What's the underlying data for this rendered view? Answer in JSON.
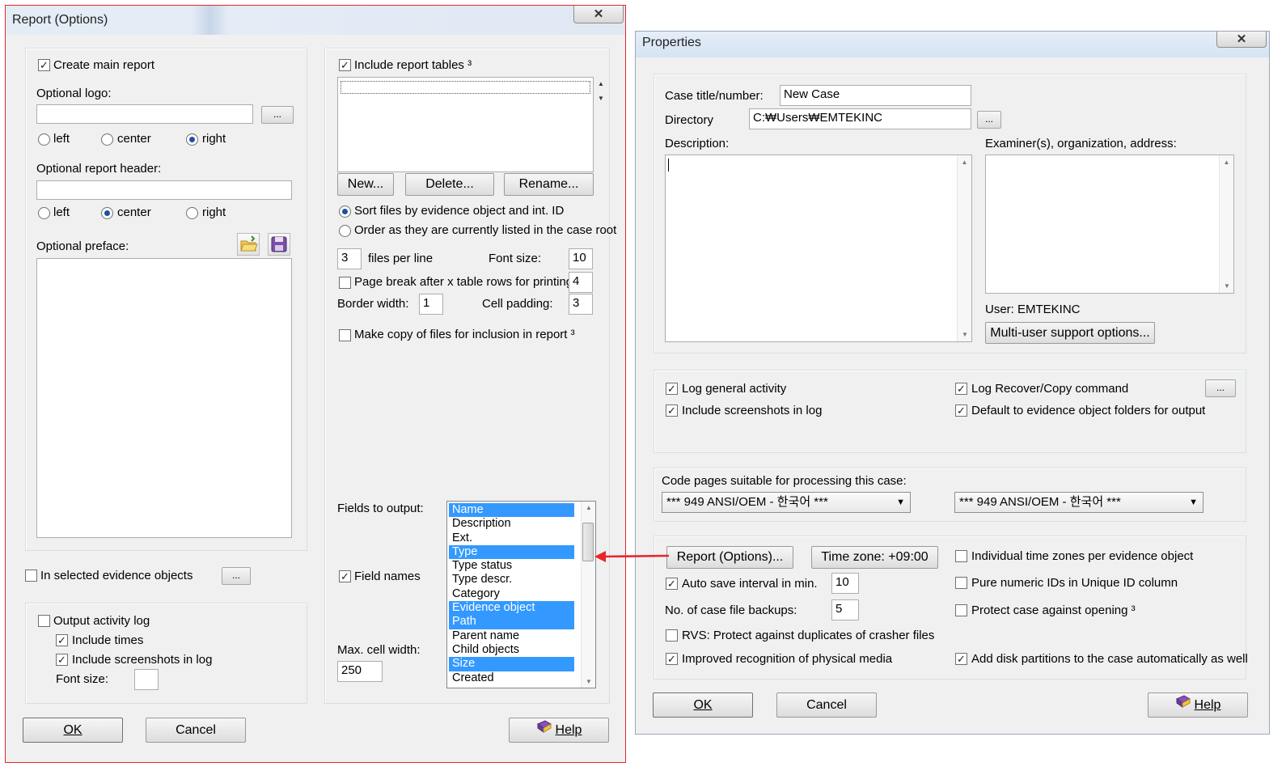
{
  "report": {
    "title": "Report (Options)",
    "close": "✕",
    "create_main_report": "Create main report",
    "optional_logo": "Optional logo:",
    "logo_value": "",
    "browse": "...",
    "align_left": "left",
    "align_center": "center",
    "align_right": "right",
    "optional_header": "Optional report header:",
    "header_value": "",
    "optional_preface": "Optional preface:",
    "in_selected": "In selected evidence objects",
    "output_activity_log": "Output activity log",
    "include_times": "Include times",
    "include_screenshots": "Include screenshots in log",
    "font_size_label": "Font size:",
    "font_size_value": "",
    "include_report_tables": "Include report tables ³",
    "new_btn": "New...",
    "delete_btn": "Delete...",
    "rename_btn": "Rename...",
    "sort_files": "Sort files by evidence object and int. ID",
    "order_listed": "Order as they are currently listed in the case root",
    "files_per_line_value": "3",
    "files_per_line": "files per line",
    "font_size2": "Font size:",
    "font_size2_value": "10",
    "page_break": "Page break after x table rows for printing:",
    "page_break_value": "4",
    "border_width": "Border width:",
    "border_width_value": "1",
    "cell_padding": "Cell padding:",
    "cell_padding_value": "3",
    "make_copy": "Make copy of files for inclusion in report ³",
    "fields_to_output": "Fields to output:",
    "field_names": "Field names",
    "max_cell_width": "Max. cell width:",
    "max_cell_width_value": "250",
    "fields": [
      {
        "label": "Name",
        "selected": true
      },
      {
        "label": "Description",
        "selected": false
      },
      {
        "label": "Ext.",
        "selected": false
      },
      {
        "label": "Type",
        "selected": true
      },
      {
        "label": "Type status",
        "selected": false
      },
      {
        "label": "Type descr.",
        "selected": false
      },
      {
        "label": "Category",
        "selected": false
      },
      {
        "label": "Evidence object",
        "selected": true
      },
      {
        "label": "Path",
        "selected": true
      },
      {
        "label": "Parent name",
        "selected": false
      },
      {
        "label": "Child objects",
        "selected": false
      },
      {
        "label": "Size",
        "selected": true
      },
      {
        "label": "Created",
        "selected": false
      }
    ],
    "ok": "OK",
    "cancel": "Cancel",
    "help": "Help"
  },
  "properties": {
    "title": "Properties",
    "close": "✕",
    "case_title_label": "Case title/number:",
    "case_title_value": "New Case",
    "directory_label": "Directory",
    "directory_value": "C:₩Users₩EMTEKINC",
    "browse": "...",
    "description_label": "Description:",
    "examiner_label": "Examiner(s), organization, address:",
    "user_label": "User: EMTEKINC",
    "multi_user": "Multi-user support options...",
    "log_general": "Log general activity",
    "log_recover": "Log Recover/Copy command",
    "include_screenshots": "Include screenshots in log",
    "default_evidence": "Default to evidence object folders for output",
    "code_pages_label": "Code pages suitable for processing this case:",
    "code_page_1": "*** 949  ANSI/OEM - 한국어 ***",
    "code_page_2": "*** 949  ANSI/OEM - 한국어 ***",
    "report_options_btn": "Report (Options)...",
    "time_zone_btn": "Time zone: +09:00",
    "individual_tz": "Individual time zones per evidence object",
    "auto_save": "Auto save interval in min.",
    "auto_save_value": "10",
    "pure_numeric": "Pure numeric IDs in Unique ID column",
    "backups_label": "No. of case file backups:",
    "backups_value": "5",
    "protect_case": "Protect case against opening ³",
    "rvs_protect": "RVS: Protect against duplicates of crasher files",
    "improved_recognition": "Improved recognition of physical media",
    "add_disk_partitions": "Add disk partitions to the case automatically as well",
    "ok": "OK",
    "cancel": "Cancel",
    "help": "Help"
  },
  "colors": {
    "accent_red": "#e8262a",
    "selection": "#3399ff"
  }
}
